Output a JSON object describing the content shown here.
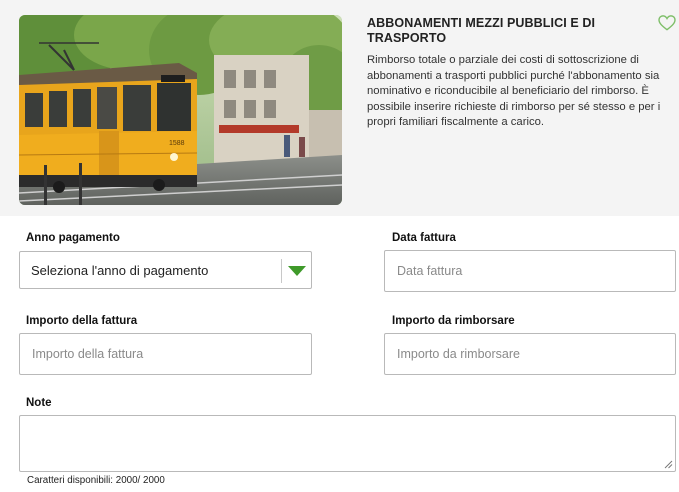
{
  "card": {
    "title": "ABBONAMENTI MEZZI PUBBLICI E DI TRASPORTO",
    "description": "Rimborso totale o parziale dei costi di sottoscrizione di abbonamenti a trasporti pubblici purché l'abbonamento sia nominativo e riconducibile al beneficiario del rimborso. È possibile inserire richieste di rimborso per sé stesso e per i propri familiari fiscalmente a carico.",
    "image_subject": "yellow tram on a tree-lined city street",
    "tram_number": "1588",
    "favorite_icon": "heart-outline-icon"
  },
  "form": {
    "anno_pagamento": {
      "label": "Anno pagamento",
      "value": "Seleziona l'anno di pagamento",
      "icon": "triangle-down-icon"
    },
    "data_fattura": {
      "label": "Data fattura",
      "placeholder": "Data fattura"
    },
    "importo_fattura": {
      "label": "Importo della fattura",
      "placeholder": "Importo della fattura"
    },
    "importo_rimborsare": {
      "label": "Importo da rimborsare",
      "placeholder": "Importo da rimborsare"
    },
    "note": {
      "label": "Note",
      "placeholder": ""
    },
    "counter": "Caratteri disponibili: 2000/ 2000"
  },
  "colors": {
    "accent_green": "#3f9a2a",
    "panel_bg": "#f4f4f4",
    "border": "#b9b9b9",
    "heart": "#7fbf6a"
  }
}
